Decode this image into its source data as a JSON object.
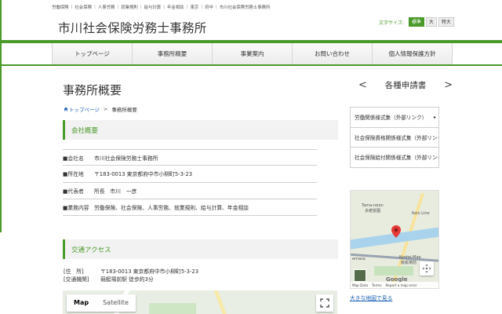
{
  "top_nav": [
    "労働保険",
    "社会保険",
    "人事労務",
    "就業規則",
    "給与計算",
    "年金相談",
    "東京",
    "府中",
    "市川社会保険労務士事務所"
  ],
  "site_title": "市川社会保険労務士事務所",
  "font_size": {
    "label": "文字サイズ:",
    "options": [
      "標準",
      "大",
      "特大"
    ],
    "active": "標準"
  },
  "global_nav": [
    "トップページ",
    "事務所概要",
    "事業案内",
    "お問い合わせ",
    "個人情報保護方針"
  ],
  "page_title": "事務所概要",
  "breadcrumb": {
    "home": "トップページ",
    "separator": ">",
    "current": "事務所概要"
  },
  "company": {
    "heading": "会社概要",
    "rows": [
      {
        "key": "■会社名",
        "value": "市川社会保険労務士事務所"
      },
      {
        "key": "■所在地",
        "value": "〒183-0013 東京都府中市小柳町5-3-23"
      },
      {
        "key": "■代表者",
        "value": "所長　市川　一彦"
      },
      {
        "key": "■業務内容",
        "value": "労働保険、社会保険、人事労務、就業規則、給与計算、年金相談"
      }
    ]
  },
  "access": {
    "heading": "交通アクセス",
    "rows": [
      {
        "key": "[住　所]",
        "value": "〒183-0013 東京都府中市小柳町5-3-23"
      },
      {
        "key": "[交通機関]",
        "value": "競艇場前駅 徒歩約3分"
      }
    ],
    "map_type": {
      "map": "Map",
      "satellite": "Satellite"
    }
  },
  "sidebar": {
    "title": "各種申請書",
    "prev_arrow": "<",
    "next_arrow": ">",
    "links": [
      "労働関係様式集（外部リンク）",
      "社会保険資格関係様式集（外部リンク）",
      "社会保険給付関係様式集（外部リンク）"
    ],
    "link_arrow": "▸",
    "map_labels": {
      "area1": "Tama-reien",
      "area1_jp": "多磨霊園",
      "road": "Keio Line",
      "station": "Kyotei-Mae",
      "station_jp": "競艇場前",
      "area2": "emasa",
      "brand": "Google"
    },
    "map_attribution": [
      "Map Data",
      "Terms",
      "Report a map error"
    ],
    "bigmap_link": "大きな地図で見る"
  },
  "colors": {
    "accent": "#4a9a2a",
    "link": "#1a5fb4"
  }
}
